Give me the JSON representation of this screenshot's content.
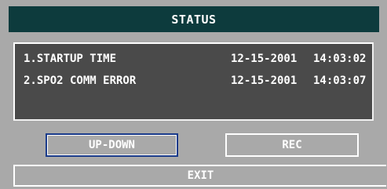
{
  "window": {
    "title": "STATUS"
  },
  "log": {
    "entries": [
      {
        "message": "1.STARTUP TIME",
        "date": "12-15-2001",
        "time": "14:03:02"
      },
      {
        "message": "2.SPO2 COMM ERROR",
        "date": "12-15-2001",
        "time": "14:03:07"
      }
    ]
  },
  "buttons": {
    "up_down": "UP-DOWN",
    "rec": "REC",
    "exit": "EXIT"
  },
  "colors": {
    "titlebar": "#0d3b3d",
    "background": "#a9a9a9",
    "log_panel": "#4a4a4a",
    "focus_border": "#1a3b8a"
  }
}
